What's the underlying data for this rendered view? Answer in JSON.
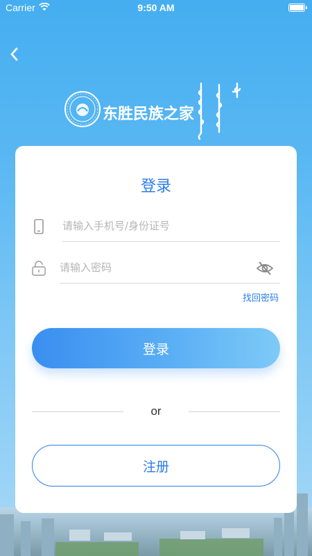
{
  "status_bar": {
    "carrier": "Carrier",
    "time": "9:50 AM"
  },
  "nav": {
    "back_icon": "chevron-left-icon"
  },
  "logo": {
    "title": "东胜民族之家",
    "emblem_icon": "emblem-logo",
    "mongolian_script": "mongolian-script-logo"
  },
  "card": {
    "title": "登录",
    "phone_field": {
      "placeholder": "请输入手机号/身份证号",
      "value": "",
      "icon": "phone-icon"
    },
    "password_field": {
      "placeholder": "请输入密码",
      "value": "",
      "icon": "lock-icon",
      "toggle_icon": "eye-hidden-icon"
    },
    "forgot_password": "找回密码",
    "login_button": "登录",
    "divider_text": "or",
    "register_button": "注册"
  },
  "colors": {
    "accent": "#2b7de9",
    "background_top": "#45aef0",
    "button_gradient_start": "#3a8ef0",
    "button_gradient_end": "#7ecaf7"
  }
}
